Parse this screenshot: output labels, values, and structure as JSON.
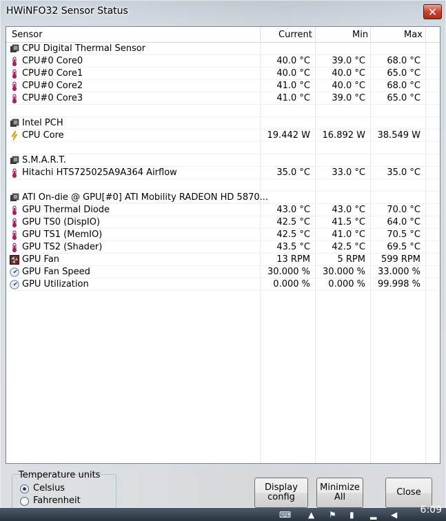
{
  "window": {
    "title": "HWiNFO32 Sensor Status",
    "close_glyph": "✕"
  },
  "columns": {
    "sensor": "Sensor",
    "current": "Current",
    "min": "Min",
    "max": "Max"
  },
  "rows": [
    {
      "type": "group",
      "icon": "chip-icon",
      "name": "CPU Digital Thermal Sensor",
      "cur": "",
      "min": "",
      "max": ""
    },
    {
      "type": "sensor",
      "icon": "thermometer-icon",
      "name": "CPU#0 Core0",
      "cur": "40.0 °C",
      "min": "39.0 °C",
      "max": "68.0 °C"
    },
    {
      "type": "sensor",
      "icon": "thermometer-icon",
      "name": "CPU#0 Core1",
      "cur": "40.0 °C",
      "min": "40.0 °C",
      "max": "65.0 °C"
    },
    {
      "type": "sensor",
      "icon": "thermometer-icon",
      "name": "CPU#0 Core2",
      "cur": "41.0 °C",
      "min": "40.0 °C",
      "max": "68.0 °C"
    },
    {
      "type": "sensor",
      "icon": "thermometer-icon",
      "name": "CPU#0 Core3",
      "cur": "41.0 °C",
      "min": "39.0 °C",
      "max": "65.0 °C"
    },
    {
      "type": "blank",
      "icon": "",
      "name": "",
      "cur": "",
      "min": "",
      "max": ""
    },
    {
      "type": "group",
      "icon": "chip-icon",
      "name": "Intel PCH",
      "cur": "",
      "min": "",
      "max": ""
    },
    {
      "type": "sensor",
      "icon": "lightning-icon",
      "name": "CPU Core",
      "cur": "19.442 W",
      "min": "16.892 W",
      "max": "38.549 W"
    },
    {
      "type": "blank",
      "icon": "",
      "name": "",
      "cur": "",
      "min": "",
      "max": ""
    },
    {
      "type": "group",
      "icon": "chip-icon",
      "name": "S.M.A.R.T.",
      "cur": "",
      "min": "",
      "max": ""
    },
    {
      "type": "sensor",
      "icon": "thermometer-icon",
      "name": "Hitachi HTS725025A9A364 Airflow",
      "cur": "35.0 °C",
      "min": "33.0 °C",
      "max": "35.0 °C"
    },
    {
      "type": "blank",
      "icon": "",
      "name": "",
      "cur": "",
      "min": "",
      "max": ""
    },
    {
      "type": "group",
      "icon": "chip-icon",
      "name": "ATI On-die @ GPU[#0] ATI Mobility RADEON HD 5870...",
      "cur": "",
      "min": "",
      "max": ""
    },
    {
      "type": "sensor",
      "icon": "thermometer-icon",
      "name": "GPU Thermal Diode",
      "cur": "43.0 °C",
      "min": "43.0 °C",
      "max": "70.0 °C"
    },
    {
      "type": "sensor",
      "icon": "thermometer-icon",
      "name": "GPU TS0 (DispIO)",
      "cur": "42.5 °C",
      "min": "41.5 °C",
      "max": "64.0 °C"
    },
    {
      "type": "sensor",
      "icon": "thermometer-icon",
      "name": "GPU TS1 (MemIO)",
      "cur": "42.5 °C",
      "min": "41.0 °C",
      "max": "70.5 °C"
    },
    {
      "type": "sensor",
      "icon": "thermometer-icon",
      "name": "GPU TS2 (Shader)",
      "cur": "43.5 °C",
      "min": "42.5 °C",
      "max": "69.5 °C"
    },
    {
      "type": "sensor",
      "icon": "fan-icon",
      "name": "GPU Fan",
      "cur": "13 RPM",
      "min": "5 RPM",
      "max": "599 RPM"
    },
    {
      "type": "sensor",
      "icon": "gauge-icon",
      "name": "GPU Fan Speed",
      "cur": "30.000 %",
      "min": "30.000 %",
      "max": "33.000 %"
    },
    {
      "type": "sensor",
      "icon": "gauge-icon",
      "name": "GPU Utilization",
      "cur": "0.000 %",
      "min": "0.000 %",
      "max": "99.998 %"
    }
  ],
  "temperature_units": {
    "label": "Temperature units",
    "options": [
      "Celsius",
      "Fahrenheit"
    ],
    "selected": "Celsius"
  },
  "buttons": {
    "display_config": "Display config",
    "minimize_all": "Minimize All",
    "close": "Close"
  },
  "taskbar": {
    "clock": "6:09"
  },
  "colors": {
    "close_red": "#c9412e",
    "thermometer": "#8c1f5a",
    "lightning": "#f0c419"
  }
}
